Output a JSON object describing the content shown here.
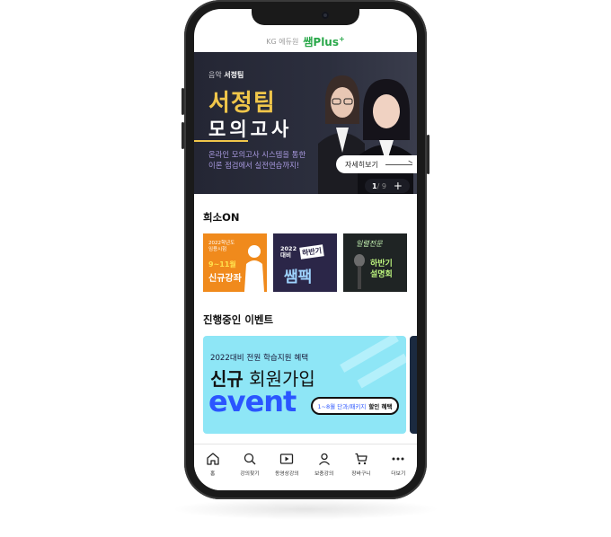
{
  "header": {
    "sub_brand": "KG 에듀원",
    "brand": "쌤Plus",
    "brand_plus": "+"
  },
  "banner": {
    "subject": "음악",
    "teacher": "서정팀",
    "title": "서정팀",
    "title2": "모의고사",
    "desc_line1": "온라인 모의고사 시스템을 통한",
    "desc_line2": "이론 점검에서 실전연습까지!",
    "more_label": "자세히보기",
    "page_current": "1",
    "page_total": "/ 9"
  },
  "section_recommend": {
    "title": "희소ON",
    "thumbs": [
      {
        "small1": "2022학년도",
        "small2": "임용시험",
        "mid": "9~11월",
        "big": "신규강좌"
      },
      {
        "year1": "2022",
        "year2": "대비",
        "half": "하반기",
        "big": "쌤팩"
      },
      {
        "script": "일렬전문",
        "a": "하반기",
        "b": "설명회"
      }
    ]
  },
  "section_event": {
    "title": "진행중인 이벤트",
    "top": "2022대비 전원 학습지원 혜택",
    "mid_bold": "신규",
    "mid_rest": " 회원가입",
    "event_word": "event",
    "pill_text": "1~8월 단과/패키지",
    "pill_bold": "할인 혜택"
  },
  "nav": [
    {
      "label": "홈",
      "icon": "home-icon"
    },
    {
      "label": "강의찾기",
      "icon": "search-icon"
    },
    {
      "label": "동영상강의",
      "icon": "play-icon"
    },
    {
      "label": "보충강의",
      "icon": "person-icon"
    },
    {
      "label": "장바구니",
      "icon": "cart-icon"
    },
    {
      "label": "더보기",
      "icon": "more-icon"
    }
  ],
  "colors": {
    "brand_green": "#2aa84a",
    "banner_gold": "#f0c64a",
    "event_bg": "#8ee6f6",
    "event_blue": "#2a55ff"
  }
}
